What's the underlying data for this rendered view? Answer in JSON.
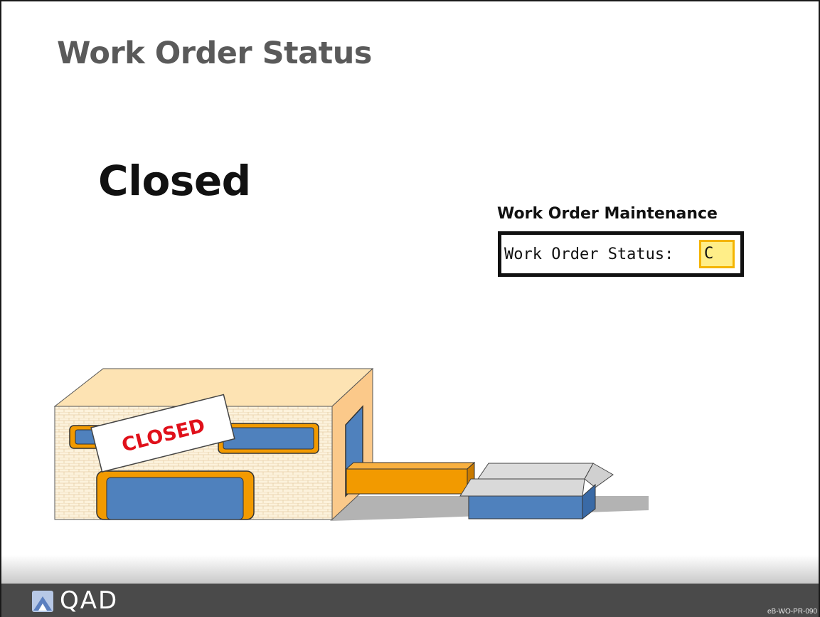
{
  "slide": {
    "title": "Work Order Status",
    "status_heading": "Closed"
  },
  "work_order_maintenance": {
    "label": "Work Order Maintenance",
    "field_label": "Work Order Status:",
    "field_value": "C"
  },
  "illustration": {
    "sign_text": "CLOSED",
    "icon": "closed-factory-illustration"
  },
  "footer": {
    "logo_text": "QAD",
    "logo_icon": "qad-logo-icon",
    "slide_code": "eB-WO-PR-090"
  },
  "colors": {
    "title": "#5a5a5a",
    "footer": "#4a4a4a",
    "field_highlight": "#ffee88",
    "field_border": "#f4b400",
    "sign_text": "#e0101a",
    "window_blue": "#4f81bd",
    "frame_orange": "#f29a00"
  }
}
